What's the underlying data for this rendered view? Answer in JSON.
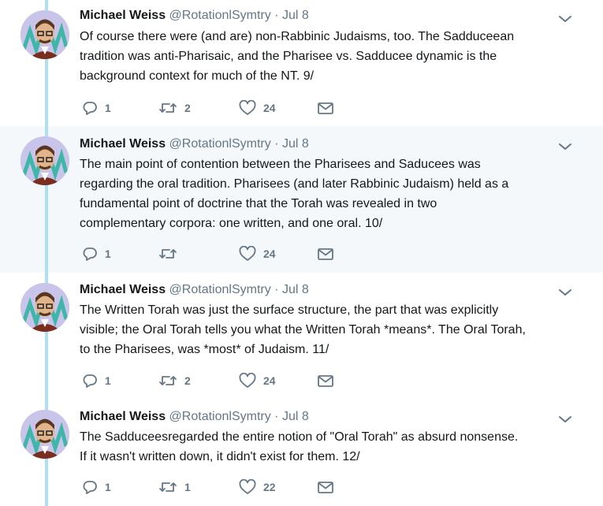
{
  "tweets": [
    {
      "name": "Michael Weiss",
      "handle": "@RotationlSymtry",
      "dot": "·",
      "date": "Jul 8",
      "text": "Of course there were (and are) non-Rabbinic Judaisms, too.  The Sadduceean\ntradition was anti-Pharisaic, and the Pharisee vs. Sadducee dynamic is the\nbackground context for much of the NT.  9/",
      "replies": "1",
      "retweets": "2",
      "likes": "24"
    },
    {
      "name": "Michael Weiss",
      "handle": "@RotationlSymtry",
      "dot": "·",
      "date": "Jul 8",
      "text": "The main point of contention between the Pharisees and Saducees was\nregarding the oral tradition. Pharisees (and later Rabbinic Judaism) held as a\nfundamental point of doctrine that the Torah was revealed in two\ncomplementary corpora: one written, and one oral. 10/",
      "replies": "1",
      "retweets": "",
      "likes": "24"
    },
    {
      "name": "Michael Weiss",
      "handle": "@RotationlSymtry",
      "dot": "·",
      "date": "Jul 8",
      "text": "The Written Torah was just the surface structure, the part that was explicitly\nvisible; the Oral Torah tells you what the Written Torah *means*. The Oral Torah,\nto the Pharisees, was *most* of Judaism.   11/",
      "replies": "1",
      "retweets": "2",
      "likes": "24"
    },
    {
      "name": "Michael Weiss",
      "handle": "@RotationlSymtry",
      "dot": "·",
      "date": "Jul 8",
      "text": "The Sadduceesregarded the entire notion of \"Oral Torah\" as absurd nonsense.\nIf it wasn't written down, it didn't exist for them.   12/",
      "replies": "1",
      "retweets": "1",
      "likes": "22"
    }
  ],
  "icons": {
    "reply": "reply-icon",
    "retweet": "retweet-icon",
    "like": "heart-icon",
    "dm": "envelope-icon",
    "more": "chevron-down-icon"
  },
  "colors": {
    "thread_line": "#aee0f4",
    "highlight_bg": "#f5f8fa",
    "muted": "#657786",
    "text": "#14171a"
  }
}
